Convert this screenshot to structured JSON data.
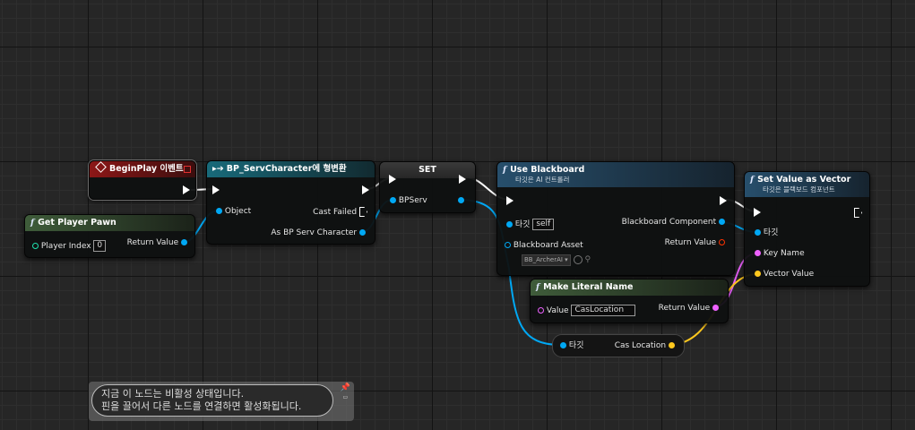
{
  "colors": {
    "exec": "#ffffff",
    "object": "#00a8f4",
    "string": "#ed61ff",
    "vector": "#ffc81e",
    "struct_red": "#d0171b",
    "int_green": "#1fe3af",
    "bool_red": "#ff3300"
  },
  "nodes": {
    "begin_play": {
      "title": "BeginPlay 이벤트"
    },
    "get_player_pawn": {
      "title": "Get Player Pawn",
      "player_index_label": "Player Index",
      "player_index_value": "0",
      "return_label": "Return Value"
    },
    "cast": {
      "title": "BP_ServCharacter에 형변환",
      "object_label": "Object",
      "cast_failed_label": "Cast Failed",
      "as_label": "As BP Serv Character"
    },
    "set": {
      "title": "SET",
      "var_label": "BPServ"
    },
    "use_blackboard": {
      "title": "Use Blackboard",
      "subtitle": "타깃은 AI 컨트롤러",
      "target_label": "타깃",
      "target_value": "self",
      "asset_label": "Blackboard Asset",
      "asset_value": "BB_ArcherAI",
      "bb_comp_label": "Blackboard Component",
      "return_label": "Return Value"
    },
    "set_value_vector": {
      "title": "Set Value as Vector",
      "subtitle": "타깃은 블랙보드 컴포넌트",
      "target_label": "타깃",
      "key_label": "Key Name",
      "vector_label": "Vector Value"
    },
    "make_literal": {
      "title": "Make Literal Name",
      "value_label": "Value",
      "value_value": "CasLocation",
      "return_label": "Return Value"
    },
    "get_var": {
      "target_label": "타깃",
      "cas_label": "Cas Location"
    }
  },
  "comment": {
    "line1": "지금 이 노드는 비활성 상태입니다.",
    "line2": "핀을 끌어서 다른 노드를 연결하면 활성화됩니다."
  }
}
